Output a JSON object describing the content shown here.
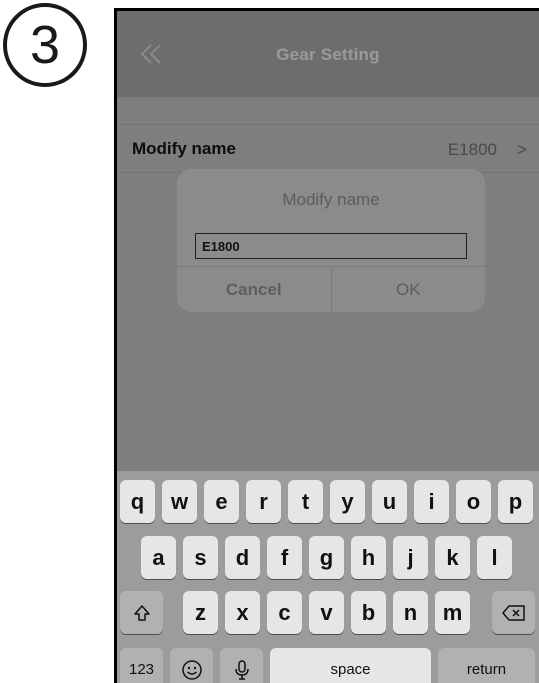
{
  "step_badge": "3",
  "nav": {
    "title": "Gear Setting",
    "back_icon": "double-chevron-left-icon"
  },
  "settings_row": {
    "label": "Modify name",
    "value": "E1800",
    "chevron": ">"
  },
  "dialog": {
    "title": "Modify name",
    "input_value": "E1800",
    "cancel_label": "Cancel",
    "ok_label": "OK"
  },
  "keyboard": {
    "row1": [
      "q",
      "w",
      "e",
      "r",
      "t",
      "y",
      "u",
      "i",
      "o",
      "p"
    ],
    "row2": [
      "a",
      "s",
      "d",
      "f",
      "g",
      "h",
      "j",
      "k",
      "l"
    ],
    "row3": [
      "z",
      "x",
      "c",
      "v",
      "b",
      "n",
      "m"
    ],
    "shift_icon": "shift-up-arrow-icon",
    "delete_icon": "backspace-icon",
    "numbers_label": "123",
    "emoji_icon": "emoji-smiley-icon",
    "mic_icon": "microphone-icon",
    "space_label": "space",
    "return_label": "return"
  },
  "colors": {
    "screen_dim": "#7e7e7e",
    "navbar": "#6d6d6d",
    "key": "#e6e6e6",
    "key_function": "#b1b1b1"
  }
}
